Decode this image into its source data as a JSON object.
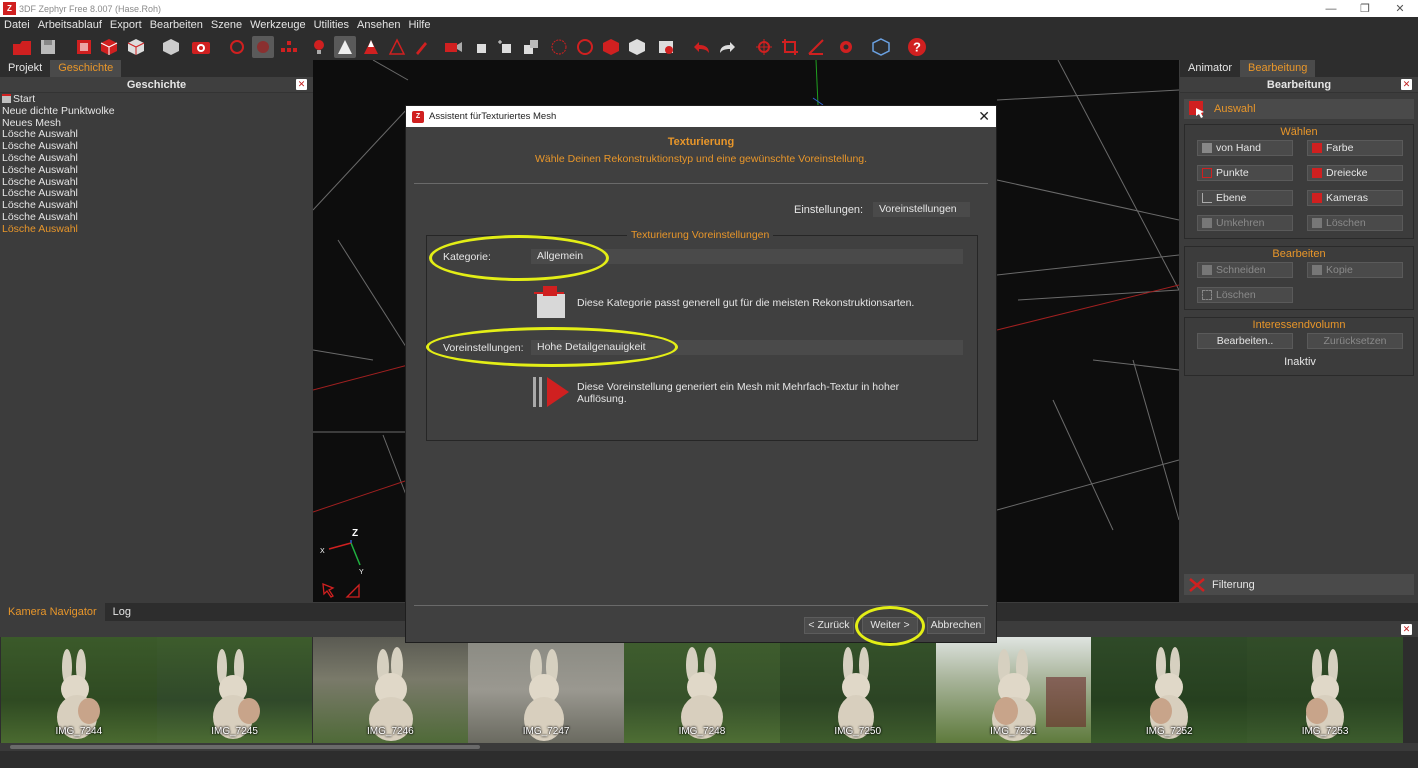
{
  "window": {
    "title": "3DF Zephyr Free 8.007 (Hase.Roh)",
    "app_icon_letter": "Z"
  },
  "menu": [
    "Datei",
    "Arbeitsablauf",
    "Export",
    "Bearbeiten",
    "Szene",
    "Werkzeuge",
    "Utilities",
    "Ansehen",
    "Hilfe"
  ],
  "left_panel": {
    "tabs": [
      "Projekt",
      "Geschichte"
    ],
    "active_tab": "Geschichte",
    "heading": "Geschichte",
    "history": [
      "Start",
      "Neue dichte Punktwolke",
      "Neues Mesh",
      "Lösche Auswahl",
      "Lösche Auswahl",
      "Lösche Auswahl",
      "Lösche Auswahl",
      "Lösche Auswahl",
      "Lösche Auswahl",
      "Lösche Auswahl",
      "Lösche Auswahl",
      "Lösche Auswahl"
    ]
  },
  "viewport": {
    "axis_z": "Z",
    "axis_x": "X",
    "axis_y": "Y"
  },
  "right_panel": {
    "tabs": [
      "Animator",
      "Bearbeitung"
    ],
    "active_tab": "Bearbeitung",
    "heading": "Bearbeitung",
    "selection_label": "Auswahl",
    "waehlen": {
      "title": "Wählen",
      "buttons": [
        "von Hand",
        "Farbe",
        "Punkte",
        "Dreiecke",
        "Ebene",
        "Kameras",
        "Umkehren",
        "Löschen"
      ]
    },
    "bearbeiten": {
      "title": "Bearbeiten",
      "buttons": [
        "Schneiden",
        "Kopie",
        "Löschen"
      ]
    },
    "interessen": {
      "title": "Interessendvolumn",
      "buttons": [
        "Bearbeiten..",
        "Zurücksetzen"
      ],
      "status": "Inaktiv"
    },
    "filter_label": "Filterung"
  },
  "bottom_panel": {
    "tabs": [
      "Kamera Navigator",
      "Log"
    ],
    "active_tab": "Kamera Navigator",
    "thumbnails": [
      "IMG_7244",
      "IMG_7245",
      "IMG_7246",
      "IMG_7247",
      "IMG_7248",
      "IMG_7250",
      "IMG_7251",
      "IMG_7252",
      "IMG_7253"
    ]
  },
  "dialog": {
    "title": "Assistent fürTexturiertes Mesh",
    "heading": "Texturierung",
    "subheading": "Wähle Deinen Rekonstruktionstyp und eine gewünschte Voreinstellung.",
    "settings_label": "Einstellungen:",
    "settings_value": "Voreinstellungen",
    "group_title": "Texturierung Voreinstellungen",
    "category_label": "Kategorie:",
    "category_value": "Allgemein",
    "category_desc": "Diese Kategorie passt generell gut für die meisten Rekonstruktionsarten.",
    "preset_label": "Voreinstellungen:",
    "preset_value": "Hohe Detailgenauigkeit",
    "preset_desc_line1": "Diese Voreinstellung generiert ein Mesh mit Mehrfach-Textur in hoher",
    "preset_desc_line2": "Auflösung.",
    "back_label": "< Zurück",
    "next_label": "Weiter >",
    "cancel_label": "Abbrechen"
  },
  "colors": {
    "accent_orange": "#e8962a",
    "highlight_yellow": "#e3ee16",
    "icon_red": "#d02020"
  }
}
